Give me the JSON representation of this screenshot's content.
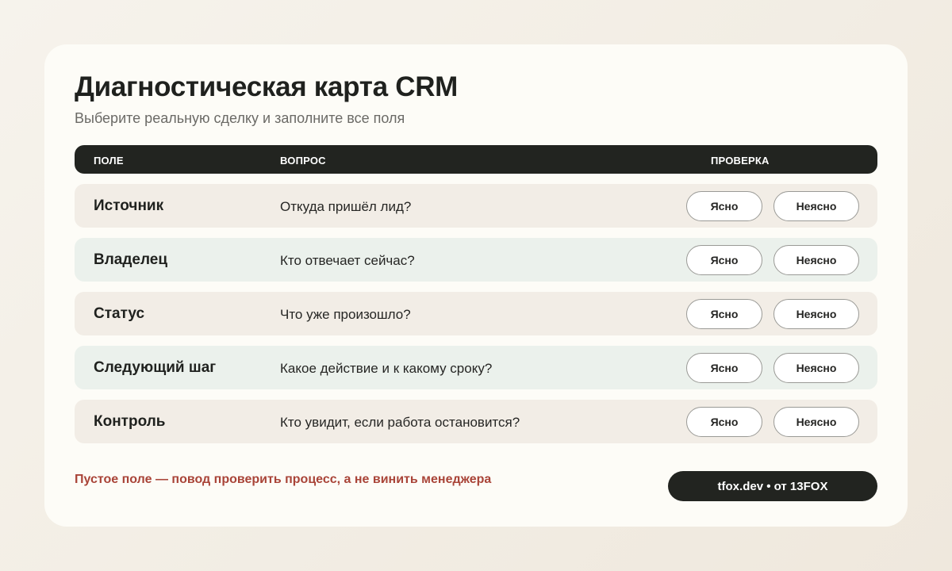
{
  "header": {
    "title": "Диагностическая карта CRM",
    "subtitle": "Выберите реальную сделку и заполните все поля"
  },
  "table": {
    "columns": [
      "ПОЛЕ",
      "ВОПРОС",
      "ПРОВЕРКА"
    ],
    "rows": [
      {
        "field": "Источник",
        "question": "Откуда пришёл лид?",
        "yes": "Ясно",
        "no": "Неясно"
      },
      {
        "field": "Владелец",
        "question": "Кто отвечает сейчас?",
        "yes": "Ясно",
        "no": "Неясно"
      },
      {
        "field": "Статус",
        "question": "Что уже произошло?",
        "yes": "Ясно",
        "no": "Неясно"
      },
      {
        "field": "Следующий шаг",
        "question": "Какое действие и к какому сроку?",
        "yes": "Ясно",
        "no": "Неясно"
      },
      {
        "field": "Контроль",
        "question": "Кто увидит, если работа остановится?",
        "yes": "Ясно",
        "no": "Неясно"
      }
    ]
  },
  "footer": {
    "note": "Пустое поле — повод проверить процесс, а не винить менеджера",
    "brand": "tfox.dev • от 13FOX"
  },
  "colors": {
    "dark": "#222420",
    "row_warm": "#f2ede6",
    "row_cool": "#ebf1ec",
    "accent_red": "#a94438"
  }
}
